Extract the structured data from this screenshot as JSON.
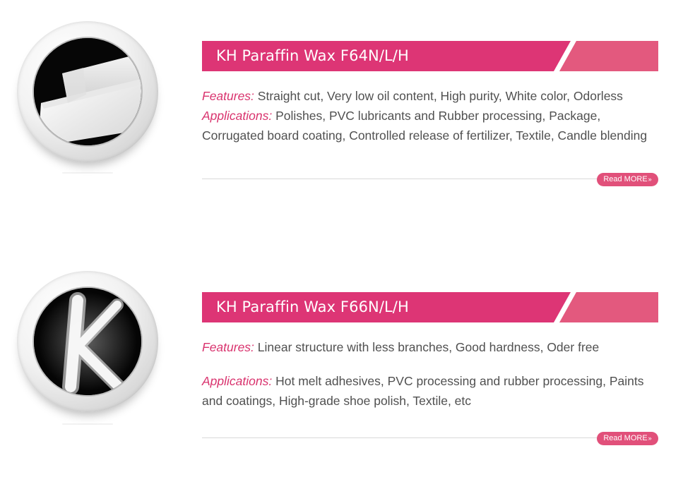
{
  "colors": {
    "banner_main": "#dd3575",
    "banner_tail": "#e3597e",
    "accent": "#d9336e",
    "button": "#e1507a"
  },
  "products": [
    {
      "title": "KH Paraffin Wax F64N/L/H",
      "features_label": "Features:",
      "features_text": " Straight cut, Very low oil content, High purity, White color, Odorless",
      "applications_label": "Applications:",
      "applications_text": " Polishes, PVC lubricants and Rubber processing, Package, Corrugated board coating, Controlled release of fertilizer, Textile, Candle blending",
      "read_more": "Read MORE",
      "image_icon": "wax-slabs-image"
    },
    {
      "title": "KH Paraffin Wax F66N/L/H",
      "features_label": "Features:",
      "features_text": " Linear structure with less branches, Good hardness, Oder free",
      "applications_label": "Applications:",
      "applications_text": " Hot melt adhesives, PVC processing and rubber processing, Paints and coatings, High-grade shoe polish, Textile, etc",
      "read_more": "Read MORE",
      "image_icon": "wax-powder-k-image"
    }
  ]
}
